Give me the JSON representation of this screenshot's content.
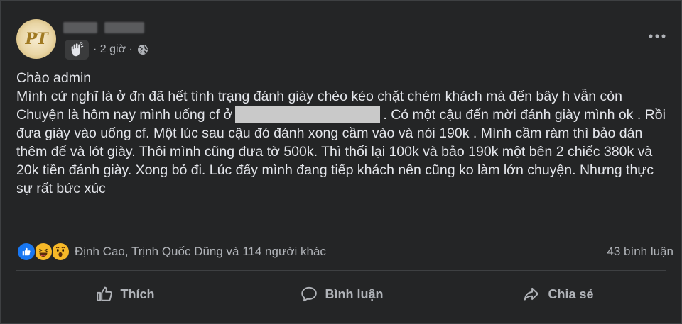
{
  "post": {
    "time": "· 2 giờ ·",
    "avatar_text": "PT",
    "body": {
      "line1": "Chào admin",
      "line2": "Mình cứ nghĩ là ở đn đã hết tình trạng đánh giày chèo kéo chặt chém khách mà đến bây h vẫn còn",
      "line3_before": "Chuyện là hôm nay mình uống cf ở",
      "line3_after": ". Có một cậu đến mời đánh giày mình ok . Rồi đưa giày vào uống cf. Một lúc sau cậu đó đánh xong cầm vào và nói 190k . Mình cầm ràm thì bảo dán thêm đế và lót giày. Thôi mình cũng đưa tờ 500k. Thì thối lại 100k và bảo 190k một bên 2 chiếc 380k và 20k tiền đánh giày. Xong bỏ đi. Lúc đấy mình đang tiếp khách nên cũng ko làm lớn chuyện. Nhưng thực sự rất bức xúc"
    }
  },
  "reactions": {
    "names": "Định Cao, Trịnh Quốc Dũng và 114 người khác",
    "comments": "43 bình luận",
    "icons": [
      "like-icon",
      "haha-icon",
      "wow-icon"
    ]
  },
  "actions": {
    "like": "Thích",
    "comment": "Bình luận",
    "share": "Chia sẻ"
  },
  "colors": {
    "background": "#242526",
    "text": "#e4e6eb",
    "secondary_text": "#b0b3b8",
    "like_blue": "#1877f2",
    "emoji_yellow": "#f7b928"
  }
}
